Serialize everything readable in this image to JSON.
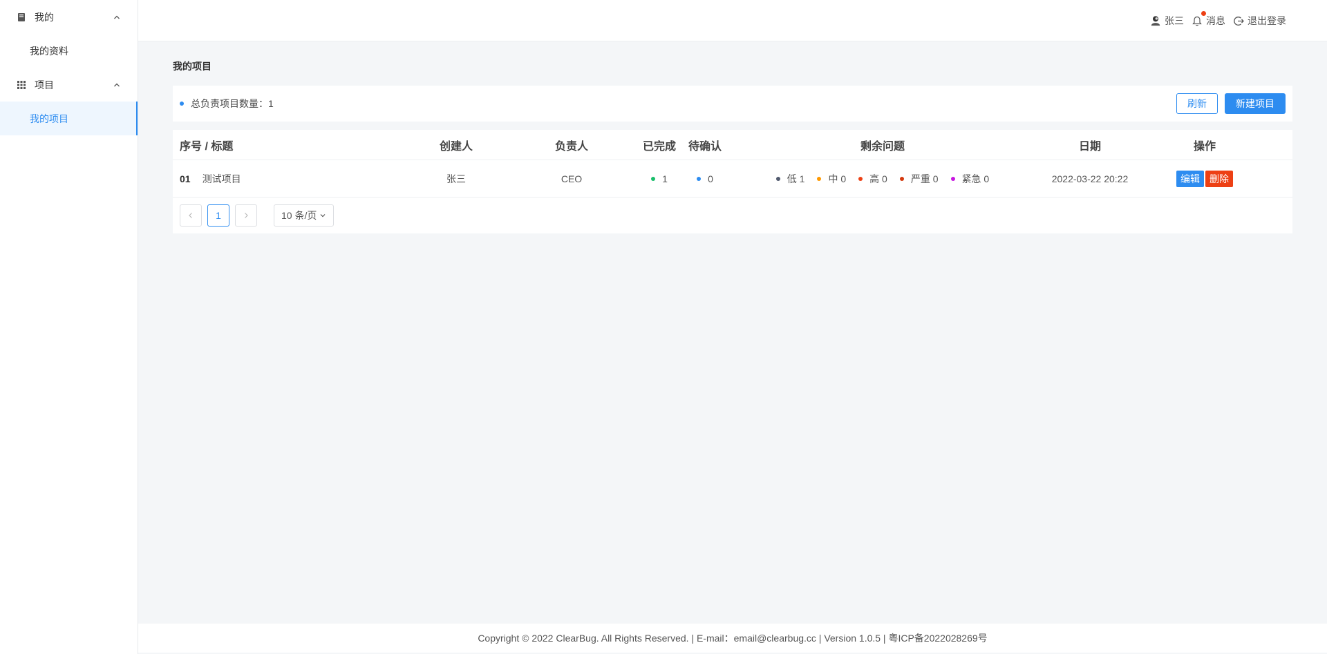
{
  "sidebar": {
    "groups": [
      {
        "label": "我的",
        "icon": "book-icon",
        "items": [
          {
            "label": "我的资料",
            "active": false
          }
        ]
      },
      {
        "label": "项目",
        "icon": "grid-icon",
        "items": [
          {
            "label": "我的项目",
            "active": true
          }
        ]
      }
    ]
  },
  "header": {
    "user_name": "张三",
    "messages_label": "消息",
    "logout_label": "退出登录"
  },
  "main": {
    "title": "我的项目",
    "summary_label": "总负责项目数量：",
    "summary_value": "1",
    "refresh_label": "刷新",
    "new_project_label": "新建项目"
  },
  "table": {
    "columns": [
      "序号 / 标题",
      "创建人",
      "负责人",
      "已完成",
      "待确认",
      "剩余问题",
      "日期",
      "操作"
    ],
    "rows": [
      {
        "no": "01",
        "title": "测试项目",
        "creator": "张三",
        "owner": "CEO",
        "done": "1",
        "pending": "0",
        "issues": [
          {
            "label": "低 1",
            "color": "#515a6e"
          },
          {
            "label": "中 0",
            "color": "#ff9900"
          },
          {
            "label": "高 0",
            "color": "#ed4014"
          },
          {
            "label": "严重 0",
            "color": "#d4380d"
          },
          {
            "label": "紧急 0",
            "color": "#c716e0"
          }
        ],
        "date": "2022-03-22 20:22",
        "edit_label": "编辑",
        "delete_label": "删除"
      }
    ]
  },
  "pager": {
    "current_page": "1",
    "page_size_label": "10 条/页"
  },
  "footer": {
    "text": "Copyright © 2022 ClearBug. All Rights Reserved. | E-mail：email@clearbug.cc | Version 1.0.5 | 粤ICP备2022028269号"
  },
  "colors": {
    "primary": "#2d8cf0",
    "danger": "#ed4014",
    "done_dot": "#19be6b",
    "pending_dot": "#2d8cf0"
  }
}
